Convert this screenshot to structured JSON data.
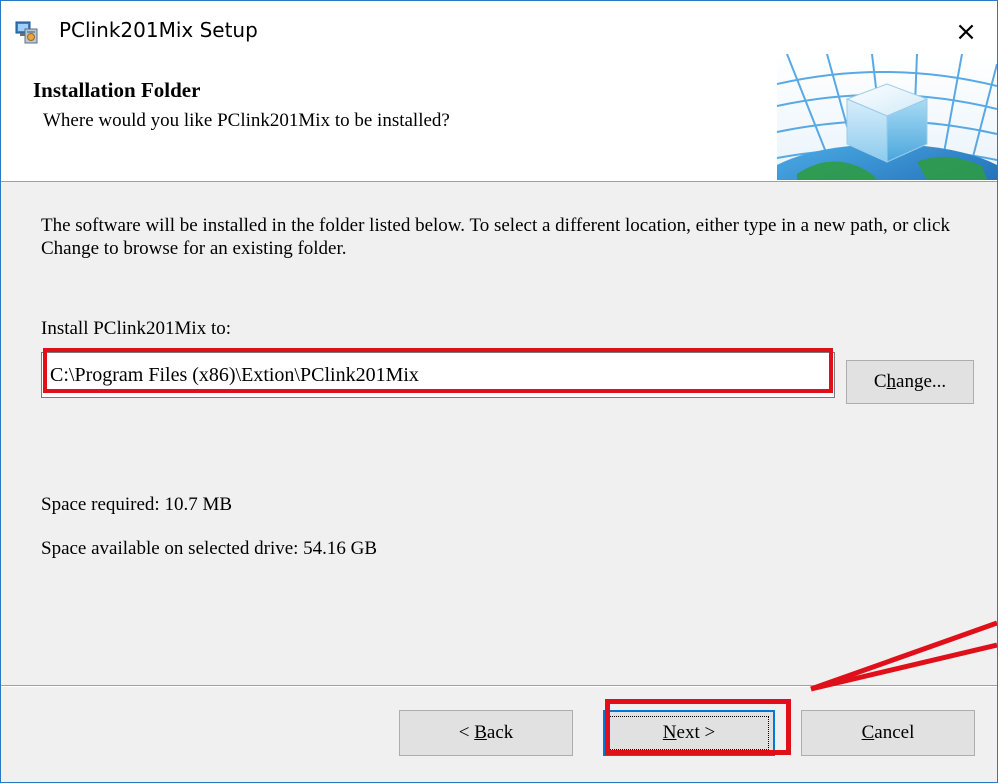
{
  "window": {
    "title": "PClink201Mix Setup",
    "close_glyph": "×"
  },
  "header": {
    "title": "Installation Folder",
    "subtitle": "Where would you like PClink201Mix to be installed?"
  },
  "body": {
    "description": "The software will be installed in the folder listed below. To select a different location, either type in a new path, or click Change to browse for an existing folder.",
    "install_label": "Install PClink201Mix to:",
    "install_path": "C:\\Program Files (x86)\\Extion\\PClink201Mix",
    "change_button": {
      "mnemonic": "h",
      "before": "C",
      "after": "ange..."
    },
    "space_required": "Space required: 10.7 MB",
    "space_available": "Space available on selected drive: 54.16 GB"
  },
  "footer": {
    "back_button": {
      "prefix": "< ",
      "mnemonic": "B",
      "after": "ack"
    },
    "next_button": {
      "mnemonic": "N",
      "after": "ext >"
    },
    "cancel_button": {
      "mnemonic": "C",
      "after": "ancel"
    }
  },
  "icons": {
    "app": "setup-installer-icon",
    "close": "close-icon",
    "banner": "globe-cube-banner"
  },
  "colors": {
    "annotation": "#e0101a",
    "focus": "#0078d7",
    "window_border": "#2b78c4",
    "dialog_bg": "#f0f0f0"
  }
}
